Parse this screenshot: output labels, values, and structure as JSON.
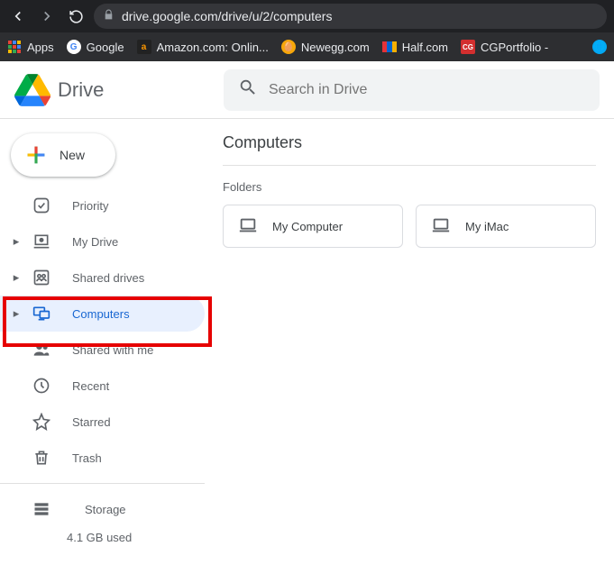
{
  "browser": {
    "url": "drive.google.com/drive/u/2/computers",
    "bookmarks": [
      {
        "label": "Apps",
        "icon": "apps"
      },
      {
        "label": "Google",
        "icon": "google"
      },
      {
        "label": "Amazon.com: Onlin...",
        "icon": "amazon"
      },
      {
        "label": "Newegg.com",
        "icon": "newegg"
      },
      {
        "label": "Half.com",
        "icon": "half"
      },
      {
        "label": "CGPortfolio -",
        "icon": "cg"
      }
    ]
  },
  "header": {
    "app_name": "Drive",
    "search_placeholder": "Search in Drive"
  },
  "sidebar": {
    "new_label": "New",
    "items": [
      {
        "label": "Priority",
        "expandable": false
      },
      {
        "label": "My Drive",
        "expandable": true
      },
      {
        "label": "Shared drives",
        "expandable": true
      },
      {
        "label": "Computers",
        "expandable": true,
        "active": true
      },
      {
        "label": "Shared with me",
        "expandable": false
      },
      {
        "label": "Recent",
        "expandable": false
      },
      {
        "label": "Starred",
        "expandable": false
      },
      {
        "label": "Trash",
        "expandable": false
      }
    ],
    "storage_label": "Storage",
    "storage_used": "4.1 GB used"
  },
  "content": {
    "title": "Computers",
    "section_label": "Folders",
    "folders": [
      {
        "label": "My Computer"
      },
      {
        "label": "My iMac"
      }
    ]
  }
}
